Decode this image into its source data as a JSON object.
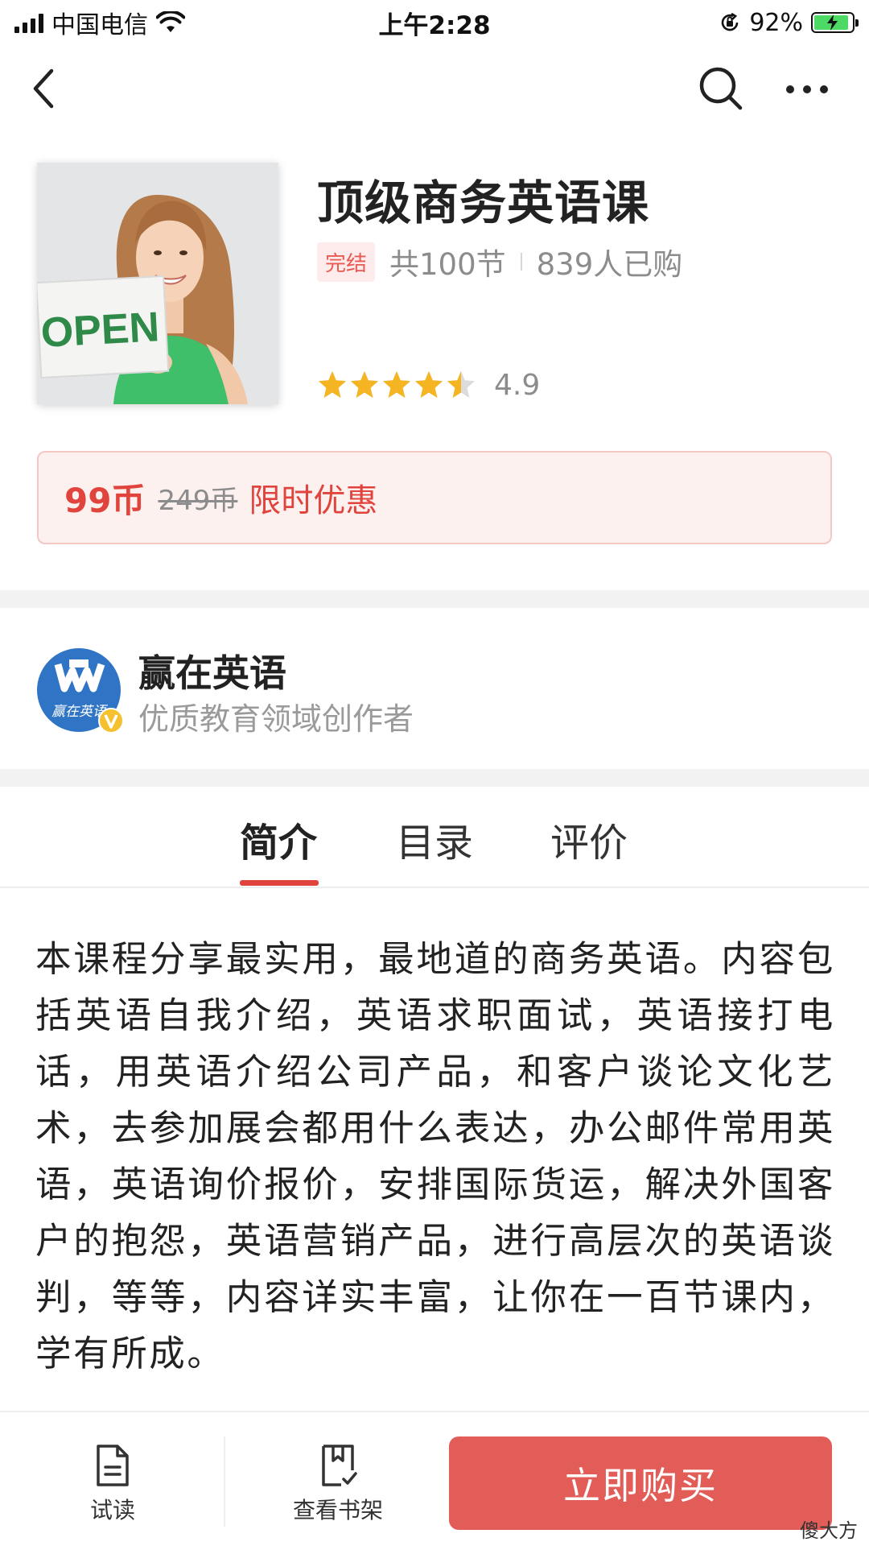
{
  "status_bar": {
    "carrier": "中国电信",
    "time": "上午2:28",
    "battery": "92%",
    "battery_level": 0.92
  },
  "nav": {
    "back_icon": "chevron-left-icon",
    "search_icon": "search-icon",
    "more_icon": "more-icon"
  },
  "product": {
    "cover_sign_text": "OPEN",
    "title": "顶级商务英语课",
    "badge": "完结",
    "lessons": "共100节",
    "buyers": "839人已购",
    "rating_value": "4.9",
    "rating_stars": 4.5,
    "star_color": "#f5b523"
  },
  "price": {
    "current": "99币",
    "original": "249币",
    "promo": "限时优惠"
  },
  "author": {
    "avatar_text": "赢在英语",
    "name": "赢在英语",
    "subtitle": "优质教育领域创作者"
  },
  "tabs": [
    {
      "label": "简介",
      "active": true
    },
    {
      "label": "目录",
      "active": false
    },
    {
      "label": "评价",
      "active": false
    }
  ],
  "description": "本课程分享最实用，最地道的商务英语。内容包括英语自我介绍，英语求职面试，英语接打电话，用英语介绍公司产品，和客户谈论文化艺术，去参加展会都用什么表达，办公邮件常用英语，英语询价报价，安排国际货运，解决外国客户的抱怨，英语营销产品，进行高层次的英语谈判，等等，内容详实丰富，让你在一百节课内，学有所成。",
  "bottom_bar": {
    "trial_label": "试读",
    "shelf_label": "查看书架",
    "buy_label": "立即购买",
    "watermark": "傻大方"
  },
  "colors": {
    "accent_red": "#e0443c",
    "buy_button": "#e25d57",
    "avatar_blue": "#2f74c5"
  }
}
